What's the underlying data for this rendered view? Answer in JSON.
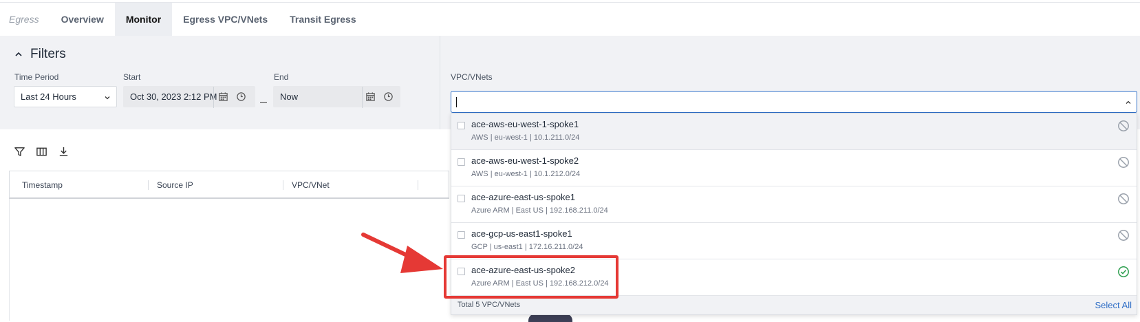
{
  "tabs": {
    "section": "Egress",
    "items": [
      {
        "label": "Overview",
        "active": false
      },
      {
        "label": "Monitor",
        "active": true
      },
      {
        "label": "Egress VPC/VNets",
        "active": false
      },
      {
        "label": "Transit Egress",
        "active": false
      }
    ]
  },
  "filters": {
    "title": "Filters",
    "time_period": {
      "label": "Time Period",
      "value": "Last 24 Hours"
    },
    "start": {
      "label": "Start",
      "value": "Oct 30, 2023 2:12 PM"
    },
    "end": {
      "label": "End",
      "value": "Now"
    },
    "vpc": {
      "label": "VPC/VNets",
      "value": ""
    }
  },
  "table": {
    "columns": [
      "Timestamp",
      "Source IP",
      "VPC/VNet"
    ]
  },
  "dropdown": {
    "options": [
      {
        "name": "ace-aws-eu-west-1-spoke1",
        "detail": "AWS | eu-west-1 | 10.1.211.0/24",
        "state": "disabled"
      },
      {
        "name": "ace-aws-eu-west-1-spoke2",
        "detail": "AWS | eu-west-1 | 10.1.212.0/24",
        "state": "disabled"
      },
      {
        "name": "ace-azure-east-us-spoke1",
        "detail": "Azure ARM | East US | 192.168.211.0/24",
        "state": "disabled"
      },
      {
        "name": "ace-gcp-us-east1-spoke1",
        "detail": "GCP | us-east1 | 172.16.211.0/24",
        "state": "disabled"
      },
      {
        "name": "ace-azure-east-us-spoke2",
        "detail": "Azure ARM | East US | 192.168.212.0/24",
        "state": "enabled"
      }
    ],
    "total": "Total 5 VPC/VNets",
    "select_all": "Select All"
  },
  "colors": {
    "accent": "#2f6ec6",
    "highlight": "#e53935",
    "enabled": "#2e9e4f",
    "disabled": "#9aa1ab"
  }
}
